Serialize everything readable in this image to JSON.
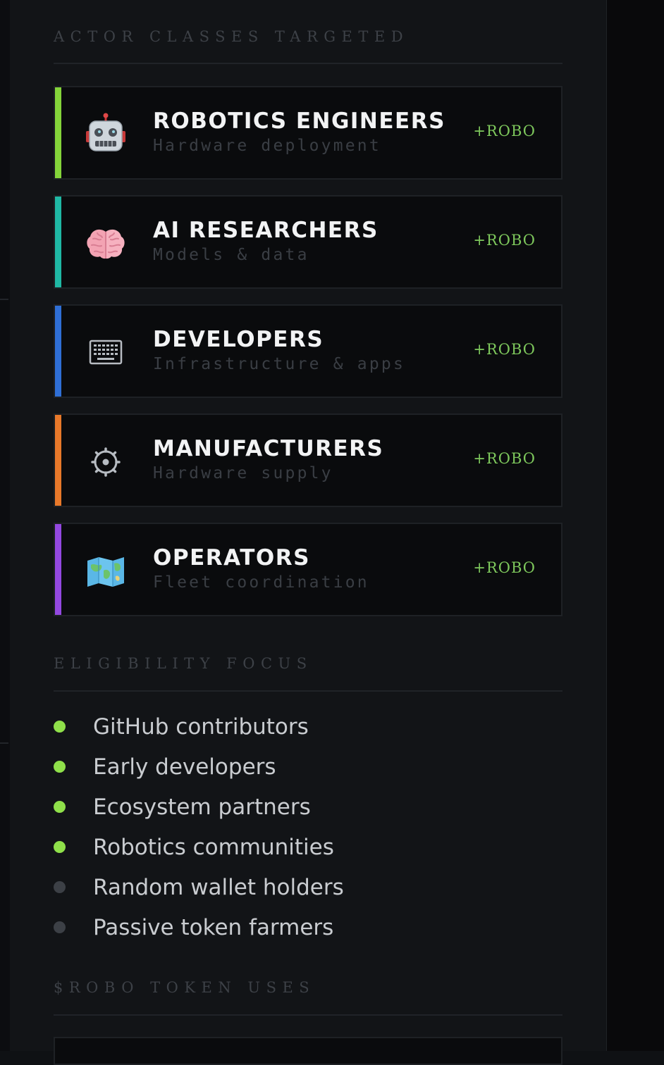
{
  "actor_classes": {
    "title": "ACTOR CLASSES TARGETED",
    "items": [
      {
        "name": "ROBOTICS ENGINEERS",
        "description": "Hardware deployment",
        "tag": "+ROBO",
        "icon": "robot-icon",
        "accent_color": "#84d43a"
      },
      {
        "name": "AI RESEARCHERS",
        "description": "Models & data",
        "tag": "+ROBO",
        "icon": "brain-icon",
        "accent_color": "#1fb8a4"
      },
      {
        "name": "DEVELOPERS",
        "description": "Infrastructure & apps",
        "tag": "+ROBO",
        "icon": "keyboard-icon",
        "accent_color": "#2f6fd6"
      },
      {
        "name": "MANUFACTURERS",
        "description": "Hardware supply",
        "tag": "+ROBO",
        "icon": "gear-icon",
        "accent_color": "#e8792a"
      },
      {
        "name": "OPERATORS",
        "description": "Fleet coordination",
        "tag": "+ROBO",
        "icon": "map-icon",
        "accent_color": "#9348e0"
      }
    ]
  },
  "eligibility": {
    "title": "ELIGIBILITY FOCUS",
    "items": [
      {
        "label": "GitHub contributors",
        "status": "included",
        "dot_color": "#8fe04a"
      },
      {
        "label": "Early developers",
        "status": "included",
        "dot_color": "#8fe04a"
      },
      {
        "label": "Ecosystem partners",
        "status": "included",
        "dot_color": "#8fe04a"
      },
      {
        "label": "Robotics communities",
        "status": "included",
        "dot_color": "#8fe04a"
      },
      {
        "label": "Random wallet holders",
        "status": "excluded",
        "dot_color": "#3c4046"
      },
      {
        "label": "Passive token farmers",
        "status": "excluded",
        "dot_color": "#3c4046"
      }
    ]
  },
  "token_uses": {
    "title": "$ROBO TOKEN USES"
  }
}
